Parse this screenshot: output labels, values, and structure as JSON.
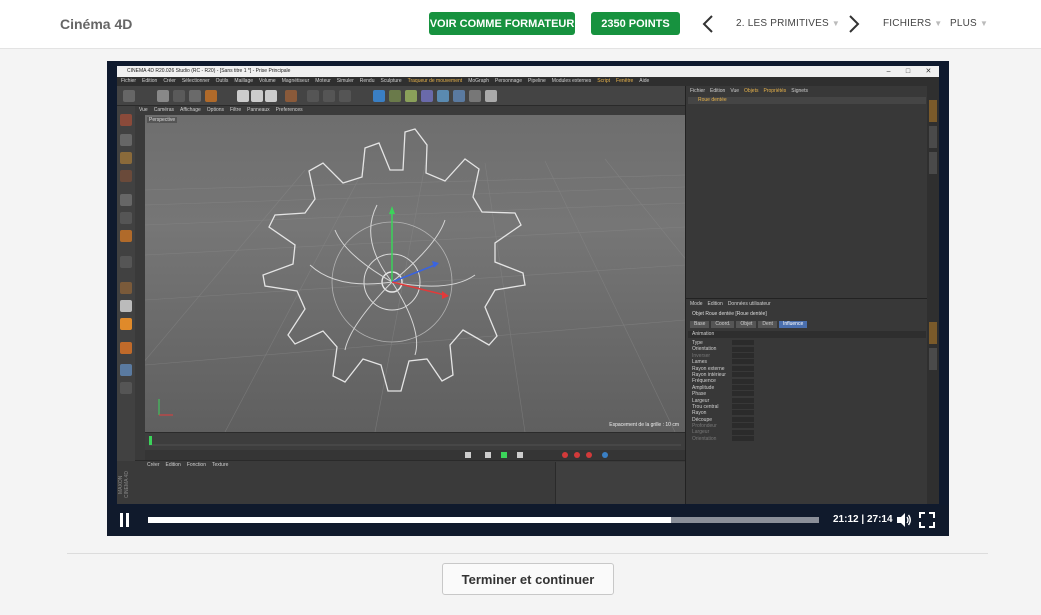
{
  "header": {
    "course_title": "Cinéma 4D",
    "trainer_button": "VOIR COMME FORMATEUR",
    "points_button": "2350 POINTS",
    "chapter_label": "2. LES PRIMITIVES",
    "files_label": "FICHIERS",
    "more_label": "PLUS",
    "accent_color": "#17923f"
  },
  "video": {
    "app_title": "CINEMA 4D R20.026 Studio (RC - R20) - [Sans titre 1 *] - Prise Principale",
    "menubar": [
      "Fichier",
      "Edition",
      "Créer",
      "Sélectionner",
      "Outils",
      "Maillage",
      "Volume",
      "Magnétiseur",
      "Moteur",
      "Simuler",
      "Rendu",
      "Sculpture",
      "Traqueur de mouvement",
      "MoGraph",
      "Personnage",
      "Pipeline",
      "Modules externes",
      "Script",
      "Fenêtre",
      "Aide"
    ],
    "viewport_menu": [
      "Vue",
      "Caméras",
      "Affichage",
      "Options",
      "Filtre",
      "Panneaux",
      "Preferences"
    ],
    "viewport_label": "Perspective",
    "grid_spacing": "Espacement de la grille : 10 cm",
    "material_menu": [
      "Créer",
      "Edition",
      "Fonction",
      "Texture"
    ],
    "object_menu": [
      "Fichier",
      "Edition",
      "Vue",
      "Objets",
      "Propriétés",
      "Signets"
    ],
    "object_name": "Roue dentée",
    "attr_menu": [
      "Mode",
      "Edition",
      "Données utilisateur"
    ],
    "attr_title": "Objet Roue dentée [Roue dentée]",
    "attr_tabs": [
      "Base",
      "Coord.",
      "Objet",
      "Dent",
      "Influence"
    ],
    "attr_section": "Animation",
    "attr_rows": [
      "Type",
      "Orientation",
      "Inverser",
      "Lames",
      "Rayon externe",
      "Rayon intérieur",
      "Fréquence",
      "Amplitude",
      "Phase",
      "Largeur",
      "Trou central",
      "Rayon",
      "Découpe",
      "Profondeur",
      "Largeur",
      "Orientation"
    ],
    "watermark": "MAXON CINEMA 4D",
    "current_time": "21:12",
    "duration": "27:14",
    "time_separator": "|",
    "progress": 0.78
  },
  "footer": {
    "finish_button": "Terminer et continuer"
  }
}
